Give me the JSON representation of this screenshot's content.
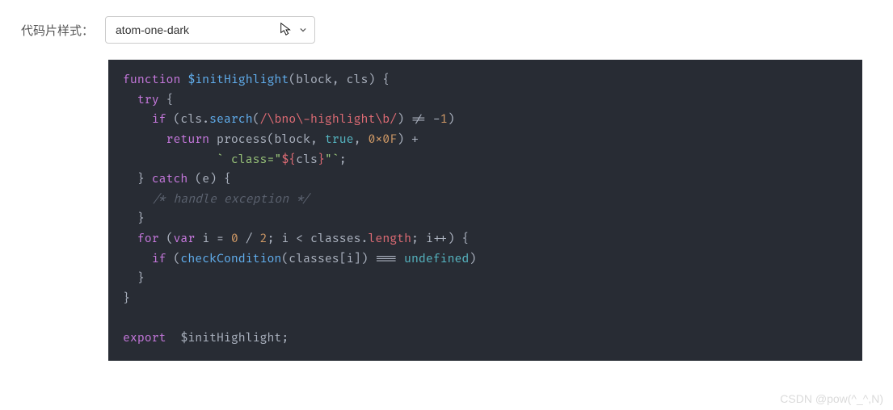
{
  "form": {
    "label": "代码片样式：",
    "selected": "atom-one-dark"
  },
  "code": {
    "l1_kw": "function",
    "l1_fn": "$initHighlight",
    "l1_open": "(block, cls) {",
    "l2_kw": "try",
    "l2_rest": " {",
    "l3_kw": "if",
    "l3_open": " (cls.",
    "l3_fn": "search",
    "l3_paren": "(",
    "l3_regex": "/\\bno\\-highlight\\b/",
    "l3_rest": ") != -",
    "l3_num": "1",
    "l3_close": ")",
    "l4_kw": "return",
    "l4_rest": " process(block, ",
    "l4_true": "true",
    "l4_comma": ", ",
    "l4_hex": "0x0F",
    "l4_plus": ") +",
    "l5_open": "`",
    "l5_str1": " class=\"",
    "l5_sub_open": "${",
    "l5_sub": "cls",
    "l5_sub_close": "}",
    "l5_str2": "\"`",
    "l5_semi": ";",
    "l6_close": "} ",
    "l6_kw": "catch",
    "l6_rest": " (e) {",
    "l7_comment": "/* handle exception */",
    "l8": "}",
    "l9_kw": "for",
    "l9_open": " (",
    "l9_var": "var",
    "l9_i": " i = ",
    "l9_n0": "0",
    "l9_div": " / ",
    "l9_n2": "2",
    "l9_rest": "; i < classes.",
    "l9_len": "length",
    "l9_end": "; i++) {",
    "l10_kw": "if",
    "l10_open": " (",
    "l10_fn": "checkCondition",
    "l10_args": "(classes[i]) === ",
    "l10_undef": "undefined",
    "l10_close": ")",
    "l11": "}",
    "l12": "}",
    "l14_kw": "export",
    "l14_rest": "  $initHighlight;"
  },
  "watermark": "CSDN @pow(^_^,N)"
}
